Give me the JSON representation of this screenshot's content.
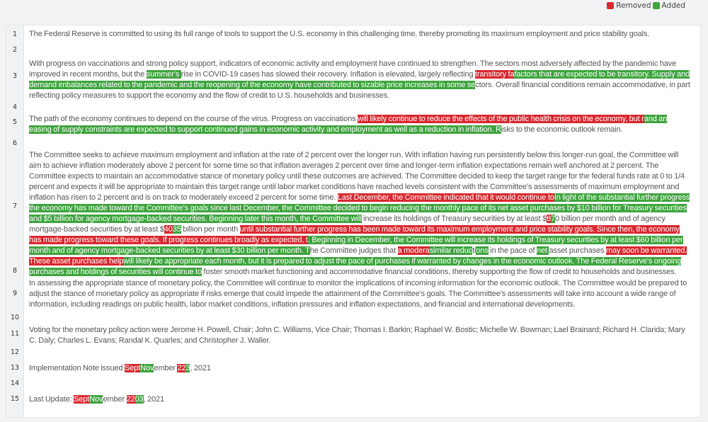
{
  "legend": {
    "removed_label": "Removed",
    "added_label": "Added",
    "removed_color": "#d9282f",
    "added_color": "#3ea43e"
  },
  "lines": [
    {
      "num": "1",
      "segments": [
        {
          "t": "n",
          "text": "The Federal Reserve is committed to using its full range of tools to support the U.S. economy in this challenging time, thereby promoting its maximum employment and price stability goals."
        }
      ]
    },
    {
      "num": "2",
      "segments": []
    },
    {
      "num": "3",
      "segments": [
        {
          "t": "n",
          "text": "With progress on vaccinations and strong policy support, indicators of economic activity and employment have continued to strengthen. The sectors most adversely affected by the pandemic have improved in recent months, but the "
        },
        {
          "t": "a",
          "text": "summer's "
        },
        {
          "t": "n",
          "text": "rise in COVID-19 cases has slowed their recovery. Inflation is elevated, largely reflecting "
        },
        {
          "t": "r",
          "text": "transitory fa"
        },
        {
          "t": "a",
          "text": "factors that are expected to be transitory. Supply and demand imbalances related to the pandemic and the reopening of the economy have contributed to sizable price increases in some se"
        },
        {
          "t": "n",
          "text": "ctors. Overall financial conditions remain accommodative, in part reflecting policy measures to support the economy and the flow of credit to U.S. households and businesses."
        }
      ]
    },
    {
      "num": "4",
      "segments": []
    },
    {
      "num": "5",
      "segments": [
        {
          "t": "n",
          "text": "The path of the economy continues to depend on the course of the virus. Progress on vaccinations "
        },
        {
          "t": "r",
          "text": "will likely continue to reduce the effects of the public health crisis on the economy, but r"
        },
        {
          "t": "a",
          "text": "and an easing of supply constraints are expected to support continued gains in economic activity and employment as well as a reduction in inflation. R"
        },
        {
          "t": "n",
          "text": "isks to the economic outlook remain."
        }
      ]
    },
    {
      "num": "6",
      "segments": []
    },
    {
      "num": "7",
      "segments": [
        {
          "t": "n",
          "text": "The Committee seeks to achieve maximum employment and inflation at the rate of 2 percent over the longer run. With inflation having run persistently below this longer-run goal, the Committee will aim to achieve inflation moderately above 2 percent for some time so that inflation averages 2 percent over time and longer-term inflation expectations remain well anchored at 2 percent. The Committee expects to maintain an accommodative stance of monetary policy until these outcomes are achieved. The Committee decided to keep the target range for the federal funds rate at 0 to 1/4 percent and expects it will be appropriate to maintain this target range until labor market conditions have reached levels consistent with the Committee's assessments of maximum employment and inflation has risen to 2 percent and is on track to moderately exceed 2 percent for some time. "
        },
        {
          "t": "r",
          "text": "Last December, the Committee indicated that it would continue to"
        },
        {
          "t": "a",
          "text": "In light of the substantial further progress the economy has made toward the Committee's goals since last December, the Committee decided to begin reducing the monthly pace of its net asset purchases by $10 billion for Treasury securities and $5 billion for agency mortgage-backed securities. Beginning later this month, the Committee will"
        },
        {
          "t": "n",
          "text": " increase its holdings of Treasury securities by at least $"
        },
        {
          "t": "r",
          "text": "8"
        },
        {
          "t": "a",
          "text": "7"
        },
        {
          "t": "n",
          "text": "0 billion per month and of agency mortgage-backed securities by at least $"
        },
        {
          "t": "r",
          "text": "40"
        },
        {
          "t": "a",
          "text": "35"
        },
        {
          "t": "n",
          "text": " billion per month "
        },
        {
          "t": "r",
          "text": "until substantial further progress has been made toward its maximum employment and price stability goals. Since then, the economy has made progress toward these goals. If progress continues broadly as expected, t"
        },
        {
          "t": "a",
          "text": ". Beginning in December, the Committee will increase its holdings of Treasury securities by at least $60 billion per month and of agency mortgage-backed securities by at least $30 billion per month. T"
        },
        {
          "t": "n",
          "text": "he Committee judges that "
        },
        {
          "t": "r",
          "text": "a modera"
        },
        {
          "t": "a",
          "text": "similar reduc"
        },
        {
          "t": "n",
          "text": "ti"
        },
        {
          "t": "a",
          "text": "ons"
        },
        {
          "t": "n",
          "text": " in the pace of "
        },
        {
          "t": "a",
          "text": "net "
        },
        {
          "t": "n",
          "text": "asset purchases "
        },
        {
          "t": "r",
          "text": "may soon be warranted. These asset purchases help"
        },
        {
          "t": "a",
          "text": "will likely be appropriate each month, but it is prepared to adjust the pace of purchases if warranted by changes in the economic outlook. The Federal Reserve's ongoing purchases and holdings of securities will continue to"
        },
        {
          "t": "n",
          "text": " foster smooth market functioning and accommodative financial conditions, thereby supporting the flow of credit to households and businesses."
        }
      ]
    },
    {
      "num": "8",
      "segments": []
    },
    {
      "num": "9",
      "segments": [
        {
          "t": "n",
          "text": "In assessing the appropriate stance of monetary policy, the Committee will continue to monitor the implications of incoming information for the economic outlook. The Committee would be prepared to adjust the stance of monetary policy as appropriate if risks emerge that could impede the attainment of the Committee's goals. The Committee's assessments will take into account a wide range of information, including readings on public health, labor market conditions, inflation pressures and inflation expectations, and financial and international developments."
        }
      ]
    },
    {
      "num": "10",
      "segments": []
    },
    {
      "num": "11",
      "segments": [
        {
          "t": "n",
          "text": "Voting for the monetary policy action were Jerome H. Powell, Chair; John C. Williams, Vice Chair; Thomas I. Barkin; Raphael W. Bostic; Michelle W. Bowman; Lael Brainard; Richard H. Clarida; Mary C. Daly; Charles L. Evans; Randal K. Quarles; and Christopher J. Waller."
        }
      ]
    },
    {
      "num": "12",
      "segments": []
    },
    {
      "num": "13",
      "segments": [
        {
          "t": "n",
          "text": "Implementation Note issued "
        },
        {
          "t": "r",
          "text": "Sept"
        },
        {
          "t": "a",
          "text": "Nov"
        },
        {
          "t": "n",
          "text": "ember "
        },
        {
          "t": "r",
          "text": "22"
        },
        {
          "t": "a",
          "text": "3"
        },
        {
          "t": "n",
          "text": ", 2021"
        }
      ]
    },
    {
      "num": "14",
      "segments": []
    },
    {
      "num": "15",
      "segments": [
        {
          "t": "n",
          "text": "Last Update: "
        },
        {
          "t": "r",
          "text": "Sept"
        },
        {
          "t": "a",
          "text": "Nov"
        },
        {
          "t": "n",
          "text": "ember "
        },
        {
          "t": "r",
          "text": "22"
        },
        {
          "t": "a",
          "text": "03"
        },
        {
          "t": "n",
          "text": ", 2021"
        }
      ]
    }
  ]
}
